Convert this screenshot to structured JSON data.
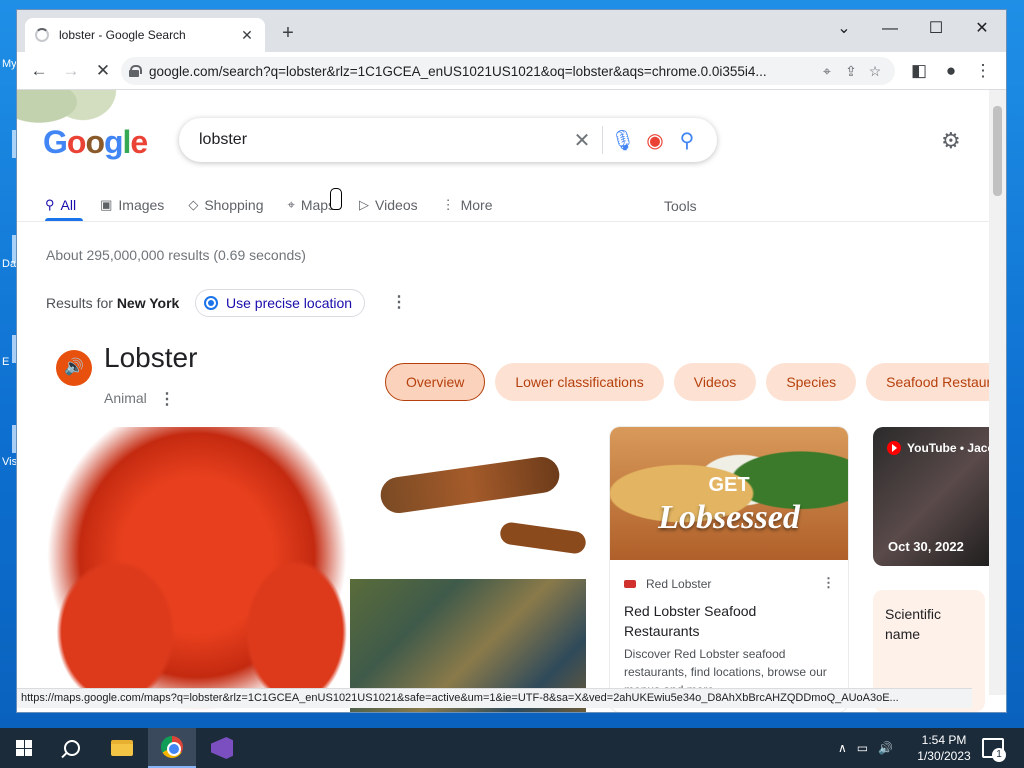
{
  "desktop": {
    "labels": [
      "My",
      "Da",
      "E",
      "Vis"
    ]
  },
  "tab": {
    "title": "lobster - Google Search",
    "close": "✕"
  },
  "window_controls": {
    "tab_search": "⌄",
    "minimize": "—",
    "maximize": "☐",
    "close": "✕"
  },
  "toolbar": {
    "back": "←",
    "forward": "→",
    "reload": "✕",
    "url": "google.com/search?q=lobster&rlz=1C1GCEA_enUS1021US1021&oq=lobster&aqs=chrome.0.0i355i4...",
    "more": "⋮"
  },
  "search": {
    "logo": "Google",
    "query": "lobster"
  },
  "nav": {
    "tabs": [
      {
        "label": "All",
        "icon": "search-icon"
      },
      {
        "label": "Images",
        "icon": "image-icon"
      },
      {
        "label": "Shopping",
        "icon": "tag-icon"
      },
      {
        "label": "Maps",
        "icon": "map-pin-icon"
      },
      {
        "label": "Videos",
        "icon": "play-icon"
      },
      {
        "label": "More",
        "icon": "dots-icon"
      }
    ],
    "tools": "Tools"
  },
  "results": {
    "stats": "About 295,000,000 results (0.69 seconds)",
    "location_prefix": "Results for",
    "location": "New York",
    "precise_location": "Use precise location"
  },
  "knowledge_panel": {
    "title": "Lobster",
    "subtitle": "Animal",
    "chips": [
      "Overview",
      "Lower classifications",
      "Videos",
      "Species",
      "Seafood Restaurants"
    ],
    "card": {
      "image_text_top": "GET",
      "image_text": "Lobsessed",
      "source": "Red Lobster",
      "title": "Red Lobster Seafood Restaurants",
      "description": "Discover Red Lobster seafood restaurants, find locations, browse our menus and more."
    },
    "video": {
      "source": "YouTube • Jaco",
      "date": "Oct 30, 2022"
    },
    "scientific_name_label": "Scientific name"
  },
  "status_url": "https://maps.google.com/maps?q=lobster&rlz=1C1GCEA_enUS1021US1021&safe=active&um=1&ie=UTF-8&sa=X&ved=2ahUKEwiu5e34o_D8AhXbBrcAHZQDDmoQ_AUoA3oE...",
  "taskbar": {
    "time": "1:54 PM",
    "date": "1/30/2023",
    "notifications": "1"
  },
  "colors": {
    "accent": "#1a73e8",
    "chip_bg": "#fde2d3",
    "chip_text": "#b6400d",
    "taskbar": "#1c2b3a"
  }
}
